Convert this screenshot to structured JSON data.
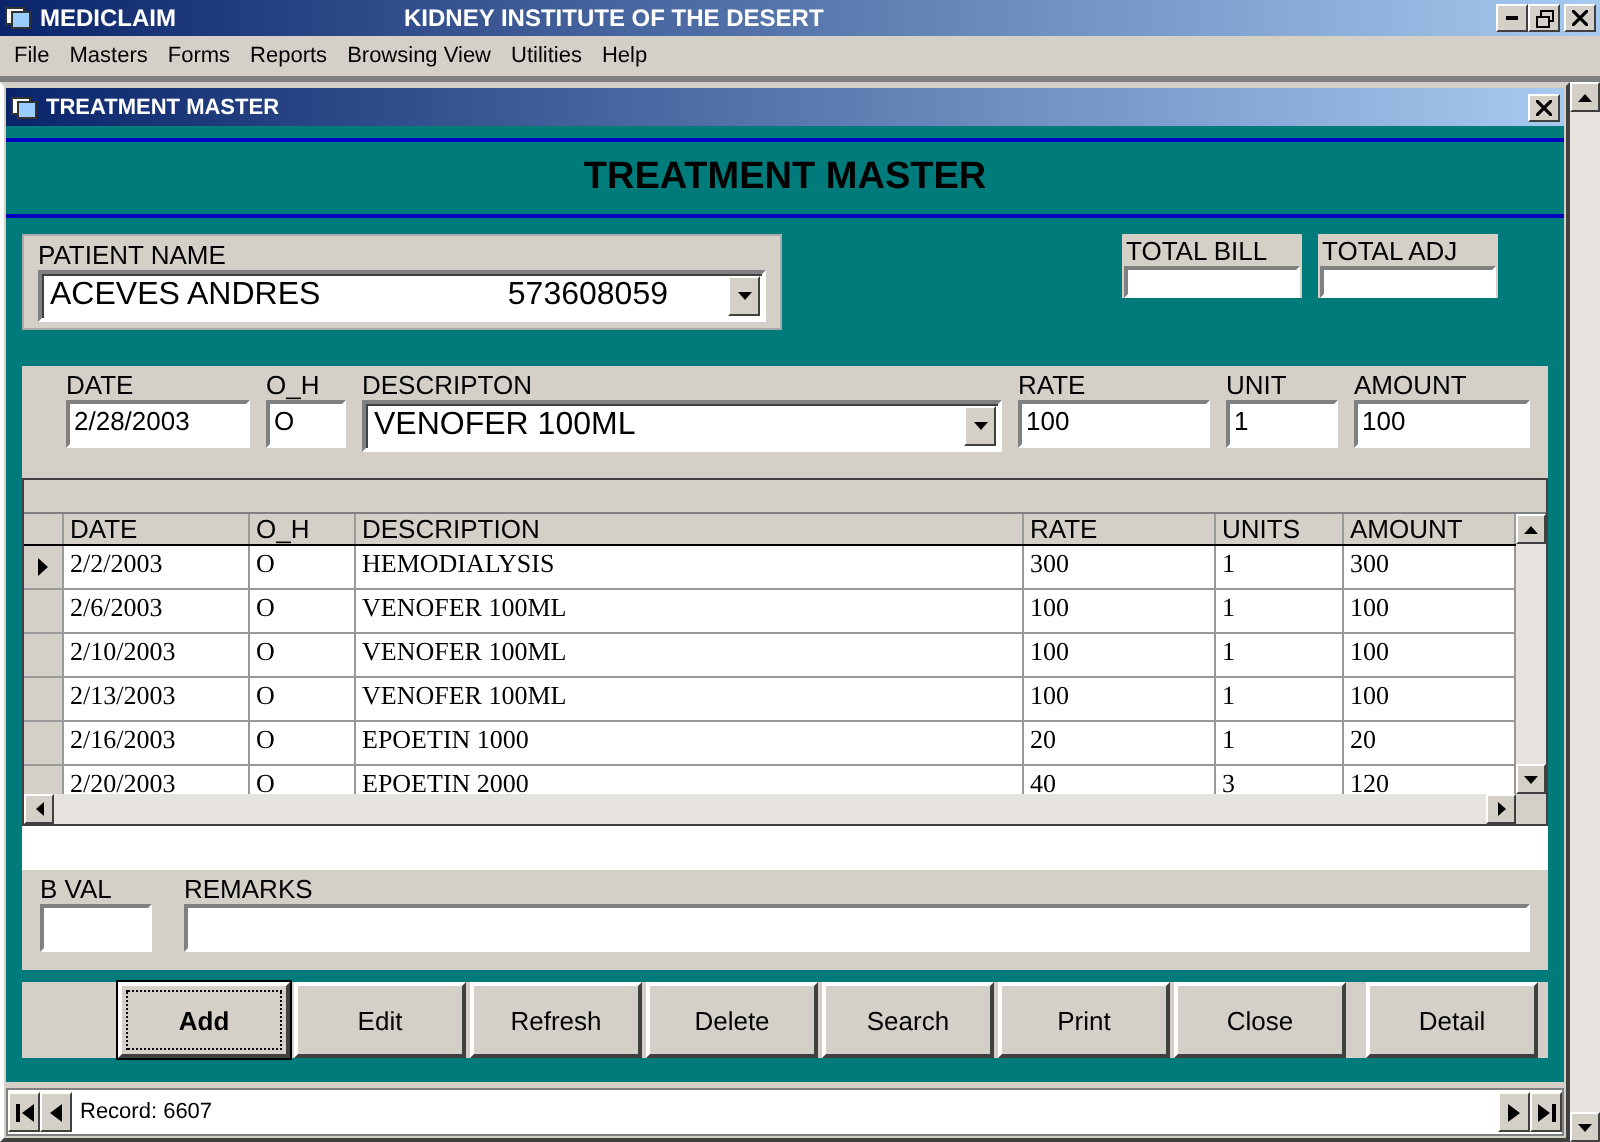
{
  "app": {
    "title": "MEDICLAIM",
    "subtitle": "KIDNEY INSTITUTE OF THE DESERT"
  },
  "menu": [
    "File",
    "Masters",
    "Forms",
    "Reports",
    "Browsing View",
    "Utilities",
    "Help"
  ],
  "form": {
    "title": "TREATMENT MASTER",
    "heading": "TREATMENT MASTER"
  },
  "patient": {
    "label": "PATIENT NAME",
    "name": "ACEVES ANDRES",
    "id": "573608059"
  },
  "totals": [
    {
      "label": "TOTAL BILL"
    },
    {
      "label": "TOTAL ADJ"
    }
  ],
  "entry": {
    "date": {
      "label": "DATE",
      "value": "2/28/2003"
    },
    "o_h": {
      "label": "O_H",
      "value": "O"
    },
    "description": {
      "label": "DESCRIPTON",
      "value": "VENOFER 100ML"
    },
    "rate": {
      "label": "RATE",
      "value": "100"
    },
    "unit": {
      "label": "UNIT",
      "value": "1"
    },
    "amount": {
      "label": "AMOUNT",
      "value": "100"
    }
  },
  "table": {
    "columns": [
      "DATE",
      "O_H",
      "DESCRIPTION",
      "RATE",
      "UNITS",
      "AMOUNT"
    ],
    "rows": [
      {
        "selected": true,
        "cells": [
          "2/2/2003",
          "O",
          "HEMODIALYSIS",
          "300",
          "1",
          "300"
        ]
      },
      {
        "selected": false,
        "cells": [
          "2/6/2003",
          "O",
          "VENOFER 100ML",
          "100",
          "1",
          "100"
        ]
      },
      {
        "selected": false,
        "cells": [
          "2/10/2003",
          "O",
          "VENOFER 100ML",
          "100",
          "1",
          "100"
        ]
      },
      {
        "selected": false,
        "cells": [
          "2/13/2003",
          "O",
          "VENOFER 100ML",
          "100",
          "1",
          "100"
        ]
      },
      {
        "selected": false,
        "cells": [
          "2/16/2003",
          "O",
          "EPOETIN 1000",
          "20",
          "1",
          "20"
        ]
      },
      {
        "selected": false,
        "cells": [
          "2/20/2003",
          "O",
          "EPOETIN 2000",
          "40",
          "3",
          "120"
        ]
      }
    ]
  },
  "bval": {
    "label": "B VAL"
  },
  "remarks": {
    "label": "REMARKS"
  },
  "buttons": [
    {
      "label": "Add",
      "focused": true
    },
    {
      "label": "Edit",
      "focused": false
    },
    {
      "label": "Refresh",
      "focused": false
    },
    {
      "label": "Delete",
      "focused": false
    },
    {
      "label": "Search",
      "focused": false
    },
    {
      "label": "Print",
      "focused": false
    },
    {
      "label": "Close",
      "focused": false
    },
    {
      "label": "Detail",
      "focused": false
    }
  ],
  "status_bar": {
    "record": "Record: 6607"
  }
}
